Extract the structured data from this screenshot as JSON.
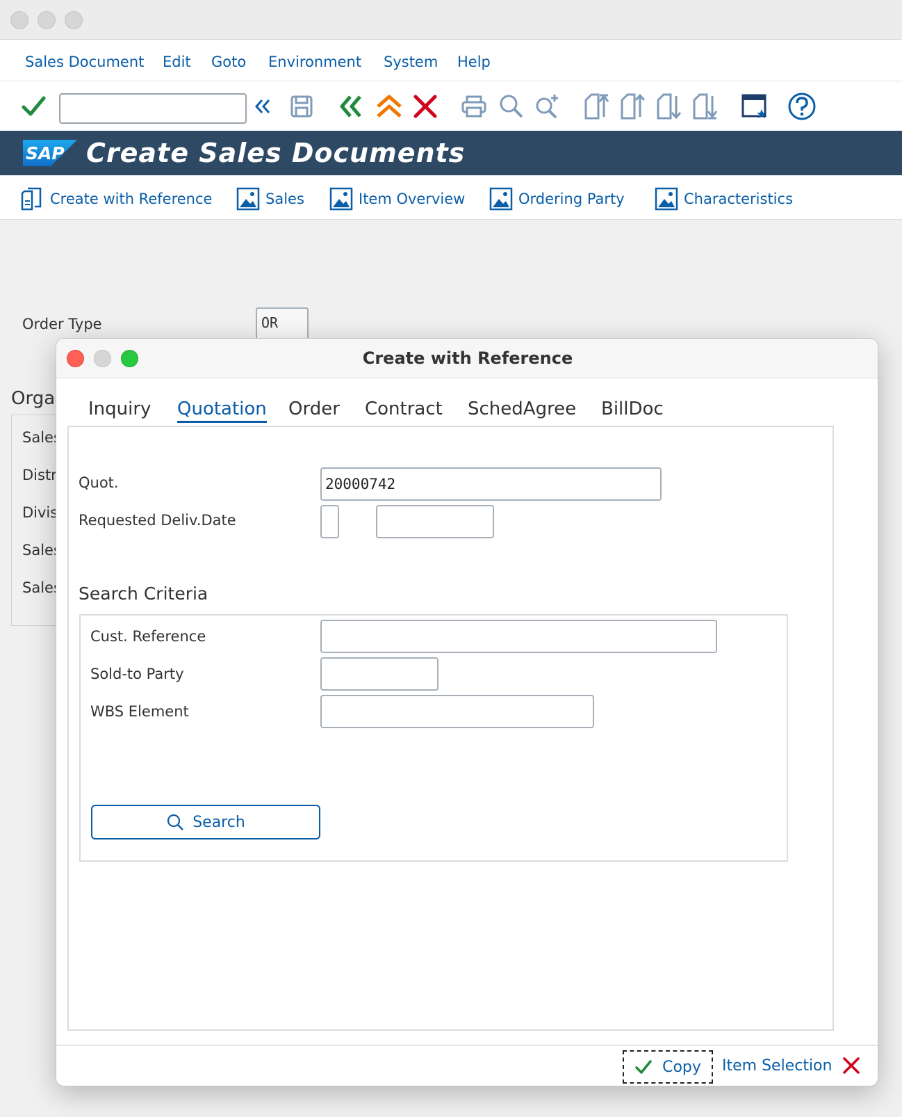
{
  "menubar": {
    "items": [
      "Sales Document",
      "Edit",
      "Goto",
      "Environment",
      "System",
      "Help"
    ]
  },
  "toolbar": {
    "command_value": "",
    "icons": [
      "enter-check-icon",
      "command-field-collapse-icon",
      "save-icon",
      "back-icon",
      "exit-icon",
      "cancel-icon",
      "print-icon",
      "find-icon",
      "find-next-icon",
      "first-page-icon",
      "previous-page-icon",
      "next-page-icon",
      "last-page-icon",
      "customize-layout-icon",
      "help-icon"
    ]
  },
  "header": {
    "logo_text": "SAP",
    "title": "Create Sales Documents"
  },
  "app_toolbar": {
    "buttons": [
      "Create with Reference",
      "Sales",
      "Item Overview",
      "Ordering Party",
      "Characteristics"
    ]
  },
  "background_form": {
    "order_type_label": "Order Type",
    "order_type_value": "OR",
    "org_section_partial": "Orga",
    "org_rows_partial": [
      "Sales",
      "Distr",
      "Divis",
      "Sales",
      "Sales"
    ]
  },
  "dialog": {
    "title": "Create with Reference",
    "tabs": [
      "Inquiry",
      "Quotation",
      "Order",
      "Contract",
      "SchedAgree",
      "BillDoc"
    ],
    "active_tab": "Quotation",
    "quot_label": "Quot.",
    "quot_value": "20000742",
    "req_deliv_date_label": "Requested Deliv.Date",
    "req_deliv_date_type": "",
    "req_deliv_date_value": "",
    "search_criteria_title": "Search Criteria",
    "cust_reference_label": "Cust. Reference",
    "cust_reference_value": "",
    "sold_to_party_label": "Sold-to Party",
    "sold_to_party_value": "",
    "wbs_element_label": "WBS Element",
    "wbs_element_value": "",
    "search_button": "Search",
    "footer": {
      "copy_label": "Copy",
      "item_selection_label": "Item Selection"
    }
  },
  "colors": {
    "accent": "#0a5ea8",
    "header_bg": "#2d4963",
    "ok_green": "#1f8a3c",
    "cancel_red": "#d0021b",
    "exit_orange": "#f07800"
  }
}
